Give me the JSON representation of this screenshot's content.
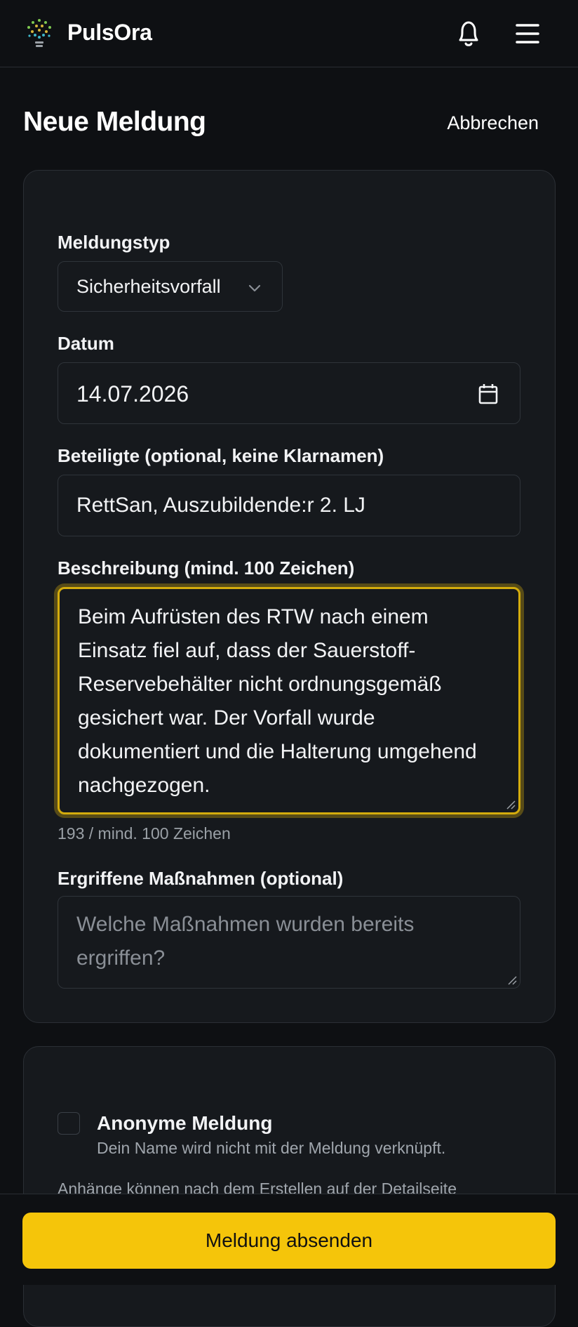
{
  "header": {
    "brand": "PulsOra",
    "icons": {
      "logo": "lightbulb-dots-icon",
      "notifications": "bell-icon",
      "menu": "hamburger-menu-icon"
    }
  },
  "page": {
    "title": "Neue Meldung",
    "cancel_label": "Abbrechen"
  },
  "form": {
    "type": {
      "label": "Meldungstyp",
      "value": "Sicherheitsvorfall"
    },
    "date": {
      "label": "Datum",
      "value": "14.07.2026"
    },
    "participants": {
      "label": "Beteiligte (optional, keine Klarnamen)",
      "value": "RettSan, Auszubildende:r 2. LJ"
    },
    "description": {
      "label": "Beschreibung (mind. 100 Zeichen)",
      "value": "Beim Aufrüsten des RTW nach einem Einsatz fiel auf, dass der Sauerstoff-Reservebehälter nicht ordnungsgemäß gesichert war. Der Vorfall wurde dokumentiert und die Halterung umgehend nachgezogen.",
      "counter": "193 / mind. 100 Zeichen"
    },
    "measures": {
      "label": "Ergriffene Maßnahmen (optional)",
      "placeholder": "Welche Maßnahmen wurden bereits ergriffen?"
    }
  },
  "options": {
    "anonymous_title": "Anonyme Meldung",
    "anonymous_sub": "Dein Name wird nicht mit der Meldung verknüpft.",
    "anonymous_checked": false,
    "attachments_note": "Anhänge können nach dem Erstellen auf der Detailseite"
  },
  "footer": {
    "submit_label": "Meldung absenden"
  },
  "colors": {
    "accent": "#f5c50a",
    "background": "#0e1013",
    "card": "#16191d",
    "focus_border": "#d4ac0d"
  }
}
